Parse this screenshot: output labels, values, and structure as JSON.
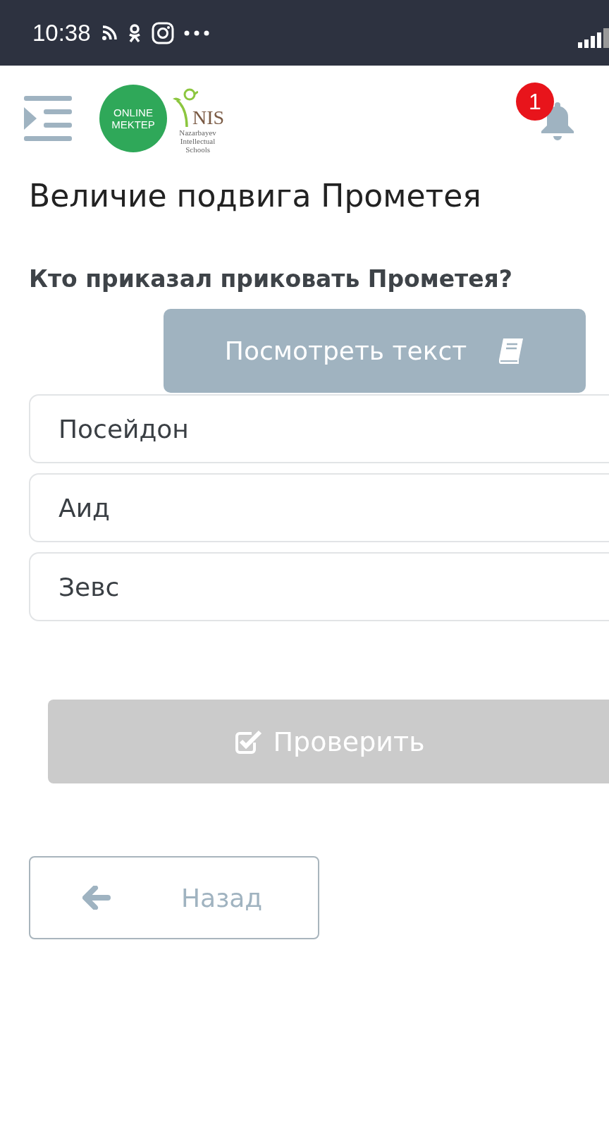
{
  "status_bar": {
    "time": "10:38"
  },
  "header": {
    "logo": {
      "line_1": "ONLINE",
      "line_2": "MEKTEP"
    },
    "school_logo": {
      "name": "NIS",
      "subtitle": [
        "Nazarbayev",
        "Intellectual",
        "Schools"
      ]
    },
    "notifications": {
      "count": "1"
    }
  },
  "title": "Величие подвига Прометея",
  "question": "Кто приказал приковать Прометея?",
  "view_text_button": {
    "label": "Посмотреть текст"
  },
  "options": [
    {
      "label": "Посейдон",
      "selected": false
    },
    {
      "label": "Аид",
      "selected": false
    },
    {
      "label": "Зевс",
      "selected": false
    }
  ],
  "check_button": {
    "label": "Проверить",
    "disabled": true
  },
  "back_button": {
    "label": "Назад"
  }
}
